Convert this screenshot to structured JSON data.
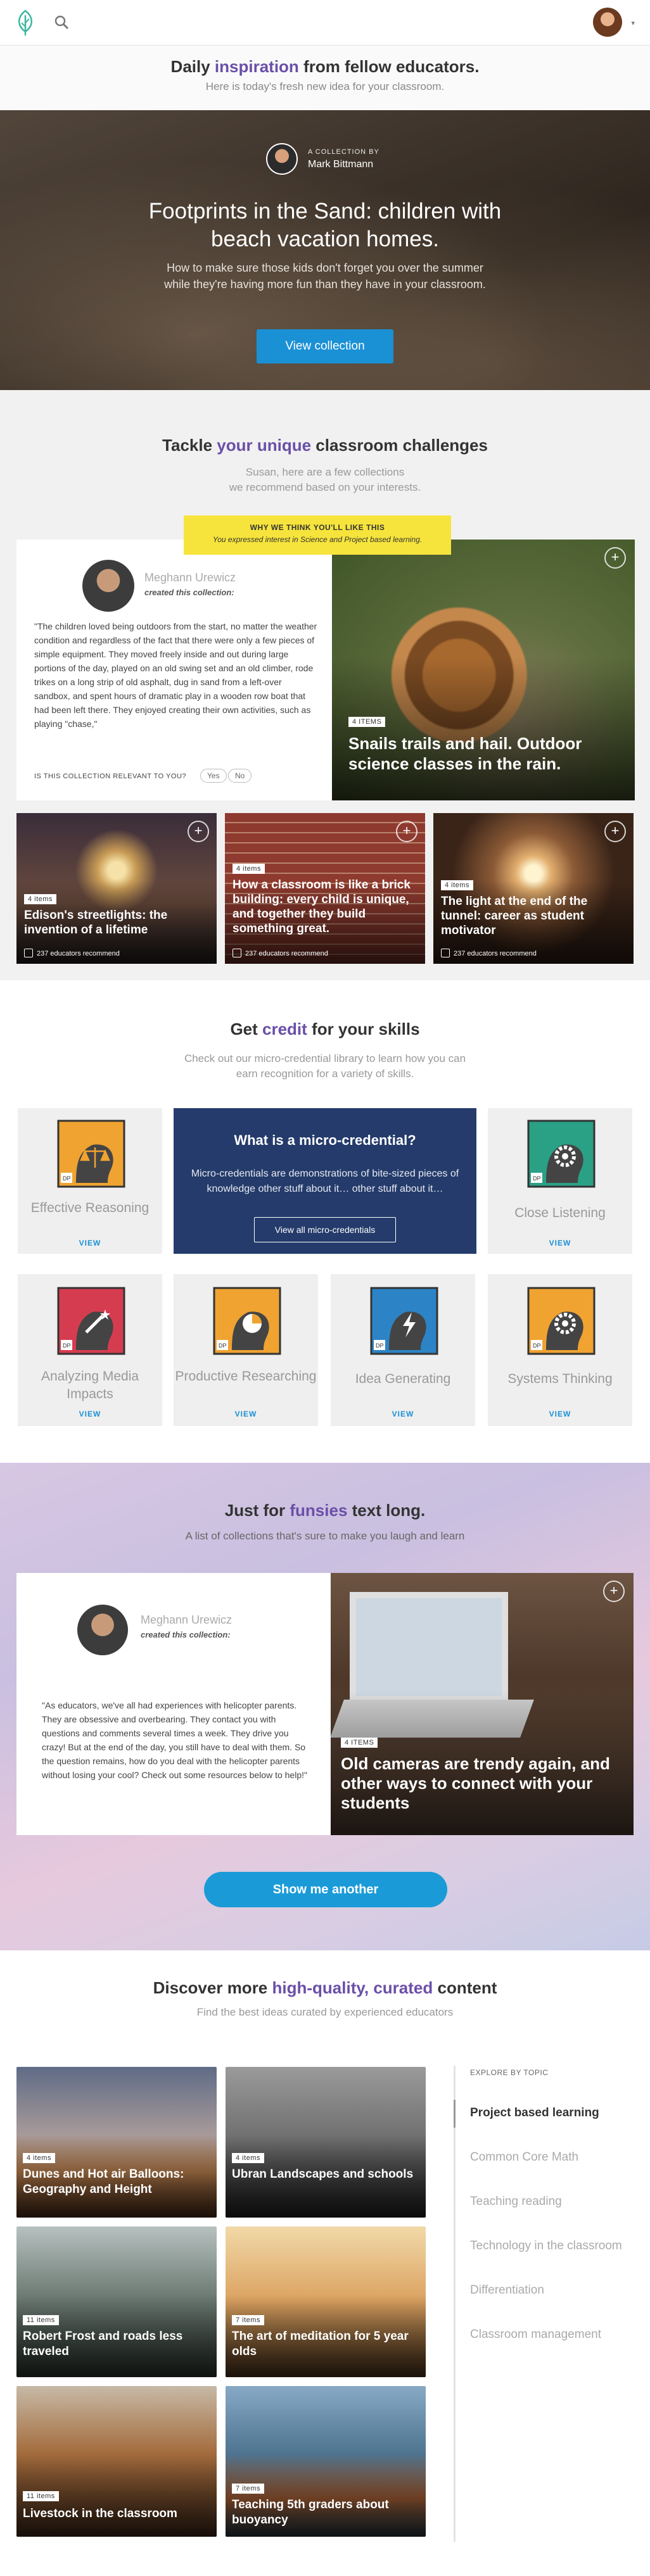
{
  "header": {
    "logo_icon": "leaf-icon",
    "search_icon": "search-icon",
    "avatar": "user-avatar",
    "menu_caret": "▾"
  },
  "daily": {
    "title_pre": "Daily ",
    "title_accent": "inspiration",
    "title_post": " from fellow educators.",
    "subtitle": "Here is today's fresh new idea for your classroom."
  },
  "hero": {
    "collection_by": "A COLLECTION BY",
    "curator": "Mark Bittmann",
    "title": "Footprints in the Sand: children with beach vacation homes.",
    "desc": "How to make sure those kids don't forget you over the summer while they're having more fun than they have in your classroom.",
    "button": "View collection"
  },
  "challenges": {
    "title_pre": "Tackle ",
    "title_accent": "your unique",
    "title_post": " classroom challenges",
    "subtitle_1": "Susan, here are a few collections",
    "subtitle_2": "we recommend based on your interests.",
    "tooltip_title": "WHY WE THINK YOU'LL LIKE THIS",
    "tooltip_text": "You expressed interest in Science and Project based learning."
  },
  "featured": {
    "curator": "Meghann Urewicz",
    "created": "created this collection:",
    "quote": "\"The children loved being outdoors from the start, no matter the weather condition and regardless of the fact that there were only a few pieces of simple equipment. They moved freely inside and out during large portions of the day, played on an old swing set and an old climber, rode trikes on a long strip of old asphalt, dug in sand from a left-over sandbox, and spent hours of dramatic play in a wooden row boat that had been left there. They enjoyed creating their own activities, such as playing \"chase,\"",
    "relevant_q": "IS THIS COLLECTION RELEVANT TO YOU?",
    "yes": "Yes",
    "no": "No",
    "badge": "4 ITEMS",
    "title": "Snails trails and hail.  Outdoor science classes in the rain.",
    "plus": "+"
  },
  "small_cards": [
    {
      "badge": "4 items",
      "title": "Edison's streetlights: the invention of a lifetime",
      "recommend": "237 educators recommend"
    },
    {
      "badge": "4 items",
      "title": "How a classroom is like a brick building: every child is unique, and together they build something great.",
      "recommend": "237 educators recommend"
    },
    {
      "badge": "4 items",
      "title": "The light at the end of the tunnel: career as student motivator",
      "recommend": "237 educators recommend"
    }
  ],
  "credit": {
    "title_pre": "Get ",
    "title_accent": "credit",
    "title_post": " for your skills",
    "subtitle_1": "Check out our micro-credential library to learn how you can",
    "subtitle_2": "earn recognition for a variety of skills.",
    "micro_title": "What is a micro-credential?",
    "micro_text": "Micro-credentials are  demonstrations of bite-sized pieces of knowledge  other stuff about it…  other stuff about it…",
    "micro_button": "View all micro-credentials",
    "view": "VIEW",
    "items": [
      {
        "name": "Effective Reasoning",
        "icon": "scales-icon",
        "color": "#f0a331"
      },
      {
        "name": "Close Listening",
        "icon": "gear-icon",
        "color": "#2aa085"
      },
      {
        "name": "Analyzing Media Impacts",
        "icon": "magic-wand-icon",
        "color": "#d63c50"
      },
      {
        "name": "Productive Researching",
        "icon": "pie-chart-icon",
        "color": "#f0a331"
      },
      {
        "name": "Idea Generating",
        "icon": "lightning-icon",
        "color": "#2c84c6"
      },
      {
        "name": "Systems Thinking",
        "icon": "gear-icon",
        "color": "#f0a331"
      }
    ],
    "dp": "DP"
  },
  "funsies": {
    "title_pre": "Just for ",
    "title_accent": "funsies",
    "title_post": " text long.",
    "subtitle": "A  list of collections that's sure to make you laugh and learn",
    "curator": "Meghann Urewicz",
    "created": "created this collection:",
    "quote": "\"As educators, we've all had experiences with helicopter parents. They are obsessive and overbearing. They contact you with questions and comments several times a week. They drive you crazy! But at the end of the day, you still have to deal with them. So the question remains, how do you deal with the helicopter parents without losing your cool? Check out some resources below to help!\"",
    "badge": "4 ITEMS",
    "card_title": "Old cameras are trendy again, and other ways to connect with your students",
    "button": "Show me another"
  },
  "discover": {
    "title_pre": "Discover more ",
    "title_accent": "high-quality, curated",
    "title_post": " content",
    "subtitle": "Find the best ideas curated by experienced educators",
    "cards": [
      {
        "badge": "4 items",
        "title": "Dunes and Hot air Balloons: Geography and Height"
      },
      {
        "badge": "4 items",
        "title": "Ubran Landscapes and schools"
      },
      {
        "badge": "11 items",
        "title": "Robert Frost and roads less traveled"
      },
      {
        "badge": "7 items",
        "title": "The art of meditation for 5 year olds"
      },
      {
        "badge": "11 items",
        "title": "Livestock in the classroom"
      },
      {
        "badge": "7 items",
        "title": "Teaching 5th graders about buoyancy"
      }
    ],
    "topics_head": "EXPLORE BY TOPIC",
    "topics": [
      "Project based learning",
      "Common Core Math",
      "Teaching reading",
      "Technology in the classroom",
      "Differentiation",
      "Classroom management"
    ]
  }
}
